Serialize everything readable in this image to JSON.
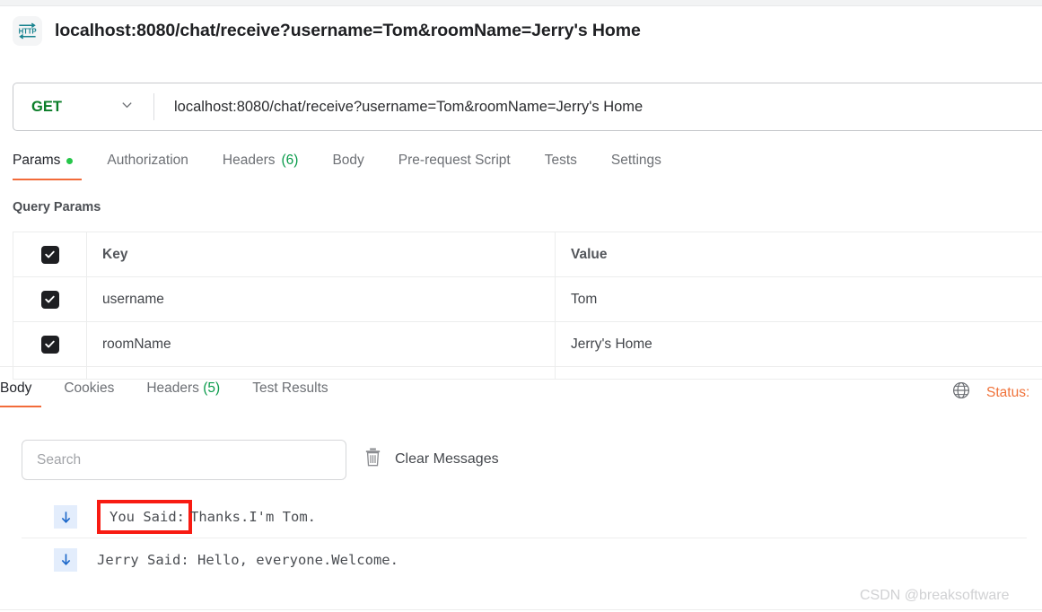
{
  "window": {
    "title": "localhost:8080/chat/receive?username=Tom&roomName=Jerry's Home",
    "icon": "http-protocol-icon"
  },
  "request_bar": {
    "method": "GET",
    "method_dropdown_icon": "chevron-down-icon",
    "url": "localhost:8080/chat/receive?username=Tom&roomName=Jerry's Home"
  },
  "request_tabs": [
    {
      "label": "Params",
      "badge": "",
      "has_dot": true,
      "active": true
    },
    {
      "label": "Authorization",
      "badge": "",
      "has_dot": false,
      "active": false
    },
    {
      "label": "Headers",
      "badge": "(6)",
      "has_dot": false,
      "active": false
    },
    {
      "label": "Body",
      "badge": "",
      "has_dot": false,
      "active": false
    },
    {
      "label": "Pre-request Script",
      "badge": "",
      "has_dot": false,
      "active": false
    },
    {
      "label": "Tests",
      "badge": "",
      "has_dot": false,
      "active": false
    },
    {
      "label": "Settings",
      "badge": "",
      "has_dot": false,
      "active": false
    }
  ],
  "query_params": {
    "section_title": "Query Params",
    "headers": {
      "key": "Key",
      "value": "Value"
    },
    "rows": [
      {
        "checked": true,
        "key": "username",
        "value": "Tom"
      },
      {
        "checked": true,
        "key": "roomName",
        "value": "Jerry's Home"
      }
    ]
  },
  "response_tabs": [
    {
      "label": "Body",
      "badge": "",
      "active": true
    },
    {
      "label": "Cookies",
      "badge": "",
      "active": false
    },
    {
      "label": "Headers",
      "badge": "(5)",
      "active": false
    },
    {
      "label": "Test Results",
      "badge": "",
      "active": false
    }
  ],
  "response_meta": {
    "globe_icon": "globe-icon",
    "status_label": "Status:"
  },
  "response_toolbar": {
    "search_placeholder": "Search",
    "search_value": "",
    "clear_icon": "trash-icon",
    "clear_label": "Clear Messages"
  },
  "messages": [
    {
      "direction_icon": "arrow-down-icon",
      "prefix": "You Said:",
      "text": "Thanks.I'm Tom.",
      "highlighted": true
    },
    {
      "direction_icon": "arrow-down-icon",
      "prefix": "",
      "text": "Jerry Said: Hello, everyone.Welcome.",
      "highlighted": false
    }
  ],
  "watermark": "CSDN @breaksoftware",
  "colors": {
    "accent_orange": "#f26b3a",
    "method_green": "#0a7d28",
    "dot_green": "#26c64a",
    "count_green": "#0a9b4b",
    "status_orange": "#f0733b",
    "highlight_red": "#f81b12",
    "icon_teal": "#18838f",
    "arrow_blue": "#1a66c9"
  }
}
